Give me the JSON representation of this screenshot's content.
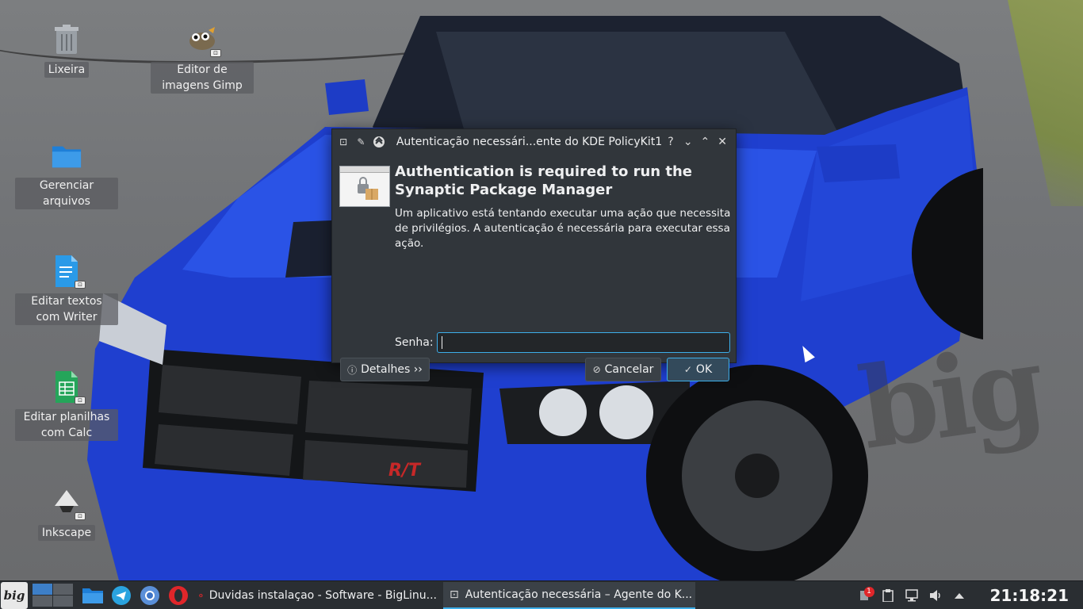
{
  "desktop": {
    "icons": [
      {
        "label": "Lixeira",
        "icon": "trash-icon"
      },
      {
        "label": "Editor de imagens Gimp",
        "icon": "gimp-icon"
      },
      {
        "label": "Gerenciar arquivos",
        "icon": "folder-icon"
      },
      {
        "label": "Editar textos com Writer",
        "icon": "writer-icon"
      },
      {
        "label": "Editar planilhas com Calc",
        "icon": "calc-icon"
      },
      {
        "label": "Inkscape",
        "icon": "inkscape-icon"
      }
    ],
    "wallpaper_logo": "big"
  },
  "dialog": {
    "title": "Autenticação necessári...ente do KDE PolicyKit1",
    "window_buttons": [
      "?",
      "⌄",
      "⌃",
      "✕"
    ],
    "heading": "Authentication is required to run the Synaptic Package Manager",
    "message": "Um aplicativo está tentando executar uma ação que necessita de privilégios. A autenticação é necessária para executar essa ação.",
    "password_label": "Senha:",
    "password_value": "",
    "details_button": "Detalhes ››",
    "cancel_button": "Cancelar",
    "ok_button": "OK"
  },
  "taskbar": {
    "menu_label": "big",
    "tasks": [
      {
        "label": "Duvidas instalaçao - Software - BigLinu...",
        "icon": "opera-icon"
      },
      {
        "label": "Autenticação necessária – Agente do K...",
        "icon": "auth-dialog-icon"
      }
    ],
    "notification_count": "1",
    "clock": "21:18:21"
  },
  "colors": {
    "accent": "#3daee9",
    "dialog_bg": "#31363b",
    "taskbar_bg": "#2a2e32"
  }
}
